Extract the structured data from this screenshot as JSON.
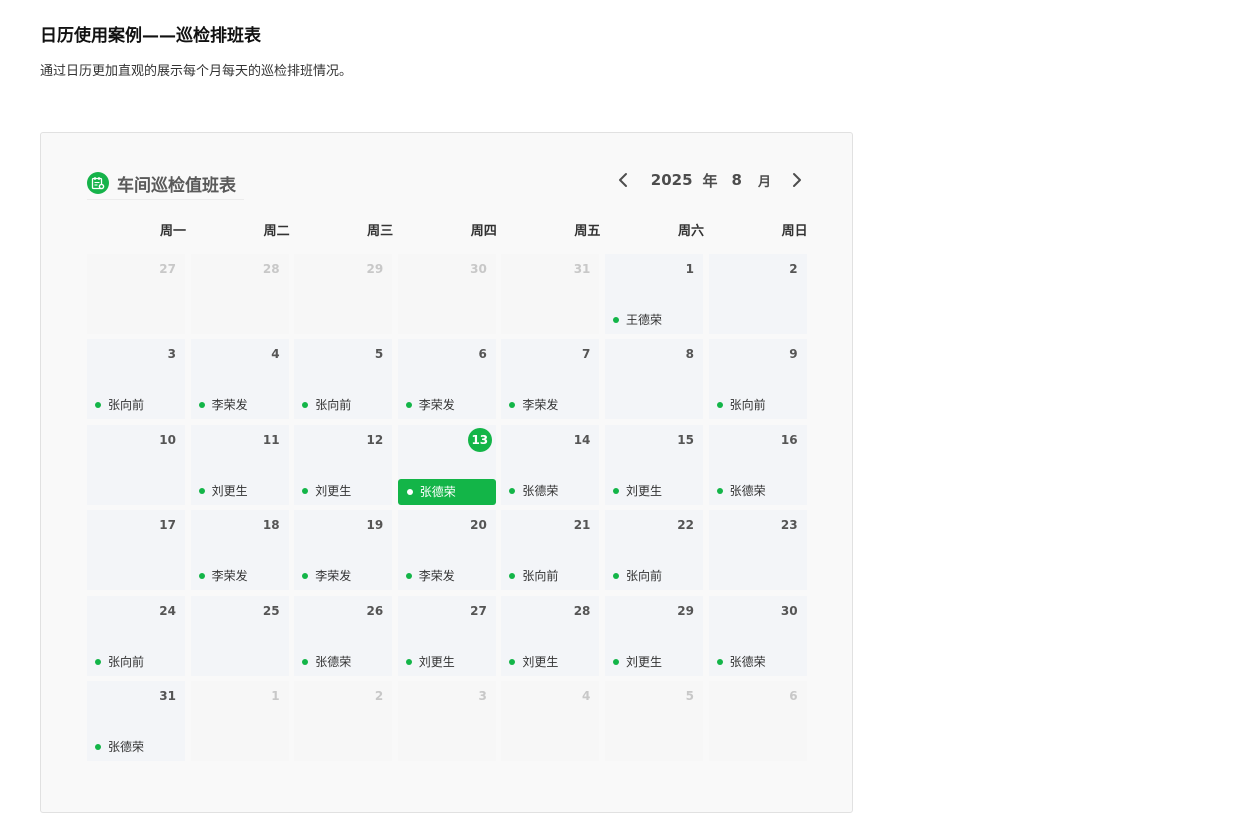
{
  "page": {
    "title": "日历使用案例——巡检排班表",
    "description": "通过日历更加直观的展示每个月每天的巡检排班情况。"
  },
  "calendar": {
    "title": "车间巡检值班表",
    "year": "2025",
    "year_unit": "年",
    "month": "8",
    "month_unit": "月",
    "accent_color": "#13b548",
    "weekdays": [
      "周一",
      "周二",
      "周三",
      "周四",
      "周五",
      "周六",
      "周日"
    ],
    "days": [
      {
        "day": "27",
        "other": true,
        "person": ""
      },
      {
        "day": "28",
        "other": true,
        "person": ""
      },
      {
        "day": "29",
        "other": true,
        "person": ""
      },
      {
        "day": "30",
        "other": true,
        "person": ""
      },
      {
        "day": "31",
        "other": true,
        "person": ""
      },
      {
        "day": "1",
        "other": false,
        "person": "王德荣"
      },
      {
        "day": "2",
        "other": false,
        "person": ""
      },
      {
        "day": "3",
        "other": false,
        "person": "张向前"
      },
      {
        "day": "4",
        "other": false,
        "person": "李荣发"
      },
      {
        "day": "5",
        "other": false,
        "person": "张向前"
      },
      {
        "day": "6",
        "other": false,
        "person": "李荣发"
      },
      {
        "day": "7",
        "other": false,
        "person": "李荣发"
      },
      {
        "day": "8",
        "other": false,
        "person": ""
      },
      {
        "day": "9",
        "other": false,
        "person": "张向前"
      },
      {
        "day": "10",
        "other": false,
        "person": ""
      },
      {
        "day": "11",
        "other": false,
        "person": "刘更生"
      },
      {
        "day": "12",
        "other": false,
        "person": "刘更生"
      },
      {
        "day": "13",
        "other": false,
        "person": "张德荣",
        "today": true
      },
      {
        "day": "14",
        "other": false,
        "person": "张德荣"
      },
      {
        "day": "15",
        "other": false,
        "person": "刘更生"
      },
      {
        "day": "16",
        "other": false,
        "person": "张德荣"
      },
      {
        "day": "17",
        "other": false,
        "person": ""
      },
      {
        "day": "18",
        "other": false,
        "person": "李荣发"
      },
      {
        "day": "19",
        "other": false,
        "person": "李荣发"
      },
      {
        "day": "20",
        "other": false,
        "person": "李荣发"
      },
      {
        "day": "21",
        "other": false,
        "person": "张向前"
      },
      {
        "day": "22",
        "other": false,
        "person": "张向前"
      },
      {
        "day": "23",
        "other": false,
        "person": ""
      },
      {
        "day": "24",
        "other": false,
        "person": "张向前"
      },
      {
        "day": "25",
        "other": false,
        "person": ""
      },
      {
        "day": "26",
        "other": false,
        "person": "张德荣"
      },
      {
        "day": "27",
        "other": false,
        "person": "刘更生"
      },
      {
        "day": "28",
        "other": false,
        "person": "刘更生"
      },
      {
        "day": "29",
        "other": false,
        "person": "刘更生"
      },
      {
        "day": "30",
        "other": false,
        "person": "张德荣"
      },
      {
        "day": "31",
        "other": false,
        "person": "张德荣"
      },
      {
        "day": "1",
        "other": true,
        "person": ""
      },
      {
        "day": "2",
        "other": true,
        "person": ""
      },
      {
        "day": "3",
        "other": true,
        "person": ""
      },
      {
        "day": "4",
        "other": true,
        "person": ""
      },
      {
        "day": "5",
        "other": true,
        "person": ""
      },
      {
        "day": "6",
        "other": true,
        "person": ""
      }
    ]
  }
}
